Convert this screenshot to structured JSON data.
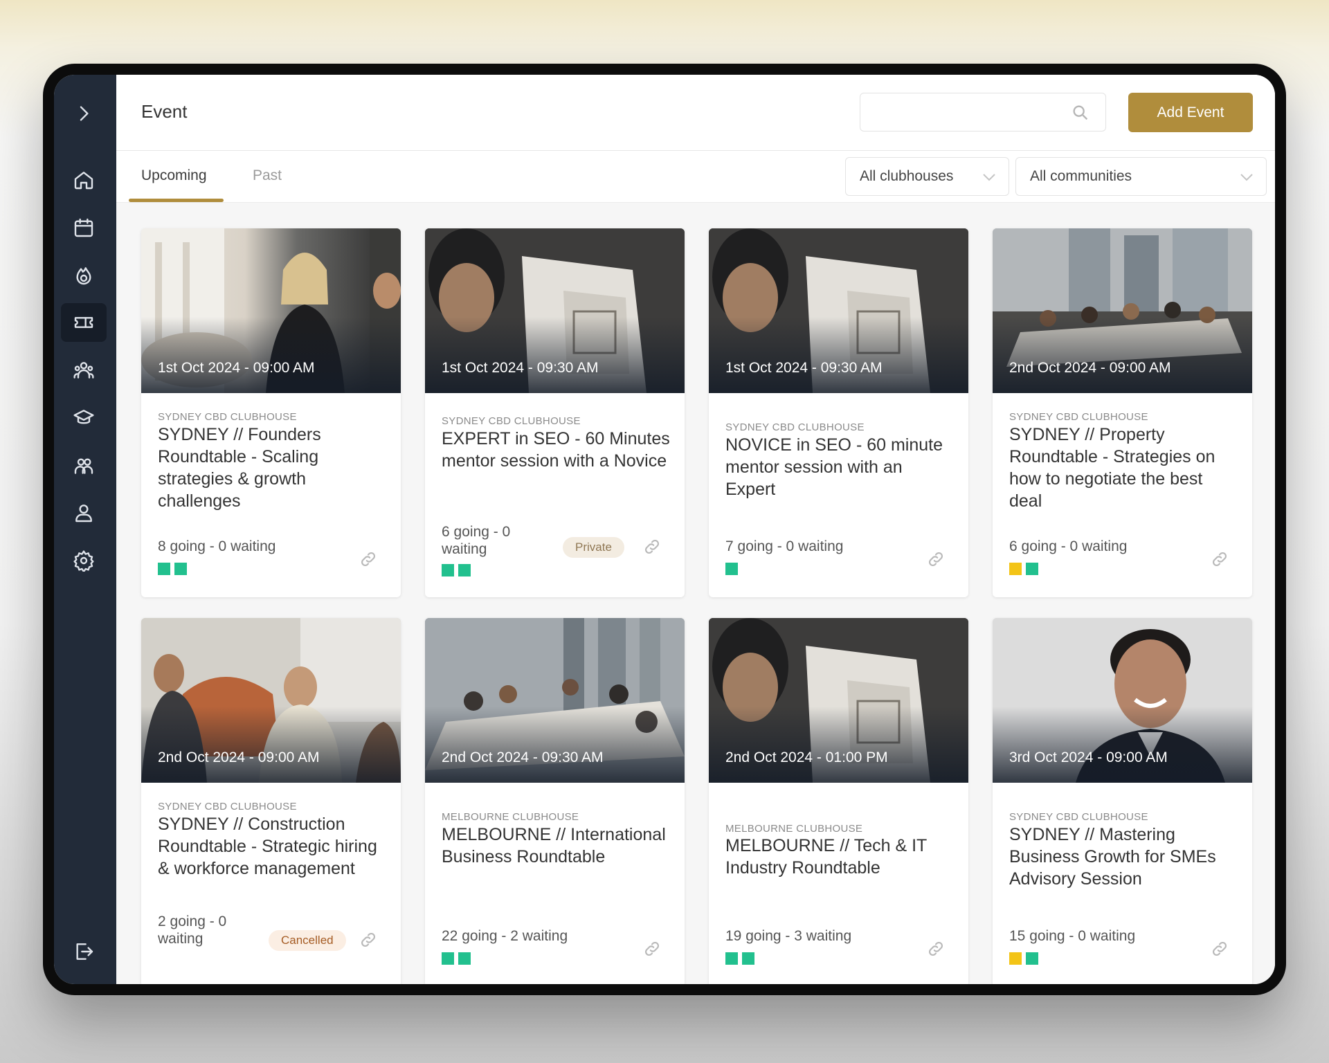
{
  "header": {
    "title": "Event",
    "search_placeholder": "",
    "add_button": "Add Event"
  },
  "tabs": [
    {
      "label": "Upcoming",
      "active": true
    },
    {
      "label": "Past",
      "active": false
    }
  ],
  "filters": {
    "clubhouse": "All clubhouses",
    "community": "All communities"
  },
  "sidebar": {
    "items": [
      {
        "icon": "chevron-right-icon"
      },
      {
        "icon": "home-icon"
      },
      {
        "icon": "calendar-icon"
      },
      {
        "icon": "flame-icon"
      },
      {
        "icon": "ticket-icon",
        "active": true
      },
      {
        "icon": "community-icon"
      },
      {
        "icon": "graduation-icon"
      },
      {
        "icon": "members-icon"
      },
      {
        "icon": "user-icon"
      },
      {
        "icon": "settings-icon"
      },
      {
        "icon": "logout-icon"
      }
    ]
  },
  "colors": {
    "accent": "#b08d3c",
    "sidebar": "#222b39",
    "status_green": "#22c08e",
    "status_yellow": "#f3c417"
  },
  "events": [
    {
      "date": "1st Oct 2024 - 09:00 AM",
      "clubhouse": "SYDNEY CBD CLUBHOUSE",
      "title": "SYDNEY // Founders Roundtable - Scaling strategies & growth challenges",
      "attendance": "8 going - 0 waiting",
      "badge": "",
      "status": [
        "green",
        "green"
      ]
    },
    {
      "date": "1st Oct 2024 - 09:30 AM",
      "clubhouse": "SYDNEY CBD CLUBHOUSE",
      "title": "EXPERT in SEO - 60 Minutes mentor session with a Novice",
      "attendance": "6 going - 0 waiting",
      "badge": "Private",
      "status": [
        "green",
        "green"
      ]
    },
    {
      "date": "1st Oct 2024 - 09:30 AM",
      "clubhouse": "SYDNEY CBD CLUBHOUSE",
      "title": "NOVICE in SEO - 60 minute mentor session with an Expert",
      "attendance": "7 going - 0 waiting",
      "badge": "",
      "status": [
        "green"
      ]
    },
    {
      "date": "2nd Oct 2024 - 09:00 AM",
      "clubhouse": "SYDNEY CBD CLUBHOUSE",
      "title": "SYDNEY // Property Roundtable - Strategies on how to negotiate the best deal",
      "attendance": "6 going - 0 waiting",
      "badge": "",
      "status": [
        "yellow",
        "green"
      ]
    },
    {
      "date": "2nd Oct 2024 - 09:00 AM",
      "clubhouse": "SYDNEY CBD CLUBHOUSE",
      "title": "SYDNEY // Construction Roundtable - Strategic hiring & workforce management",
      "attendance": "2 going - 0 waiting",
      "badge": "Cancelled",
      "status": []
    },
    {
      "date": "2nd Oct 2024 - 09:30 AM",
      "clubhouse": "MELBOURNE CLUBHOUSE",
      "title": "MELBOURNE // International Business Roundtable",
      "attendance": "22 going - 2 waiting",
      "badge": "",
      "status": [
        "green",
        "green"
      ]
    },
    {
      "date": "2nd Oct 2024 - 01:00 PM",
      "clubhouse": "MELBOURNE CLUBHOUSE",
      "title": "MELBOURNE // Tech & IT Industry Roundtable",
      "attendance": "19 going - 3 waiting",
      "badge": "",
      "status": [
        "green",
        "green"
      ]
    },
    {
      "date": "3rd Oct 2024 - 09:00 AM",
      "clubhouse": "SYDNEY CBD CLUBHOUSE",
      "title": "SYDNEY // Mastering Business Growth for SMEs Advisory Session",
      "attendance": "15 going - 0 waiting",
      "badge": "",
      "status": [
        "yellow",
        "green"
      ]
    }
  ]
}
